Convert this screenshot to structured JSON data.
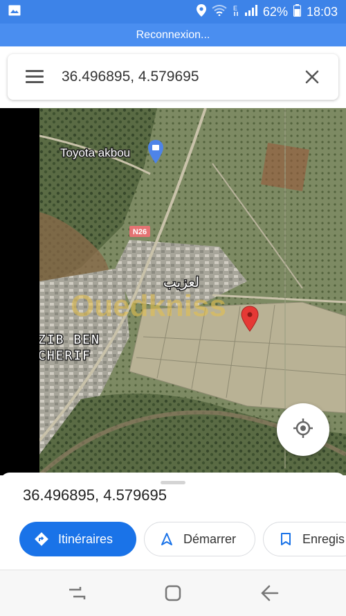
{
  "status_bar": {
    "battery": "62%",
    "time": "18:03",
    "icons": [
      "gallery-icon",
      "location-icon",
      "wifi-icon",
      "data-transfer-icon",
      "signal-icon",
      "battery-icon"
    ]
  },
  "banner": {
    "text": "Reconnexion..."
  },
  "search": {
    "value": "36.496895, 4.579695",
    "menu_icon": "menu-icon",
    "clear_icon": "close-icon"
  },
  "map": {
    "labels": {
      "toyota": "Toyota akbou",
      "route": "N26",
      "town_arabic": "لعزيب",
      "town_latin_line1": "ZIB BEN",
      "town_latin_line2": "CHERIF",
      "watermark": "Ouedkniss"
    },
    "pin_color": "#e53935",
    "locate_icon": "my-location-icon"
  },
  "sheet": {
    "coords": "36.496895, 4.579695",
    "buttons": {
      "directions": "Itinéraires",
      "start": "Démarrer",
      "save": "Enregis"
    },
    "accent": "#1a73e8"
  },
  "nav": {
    "icons": [
      "recents-icon",
      "home-icon",
      "back-icon"
    ]
  }
}
